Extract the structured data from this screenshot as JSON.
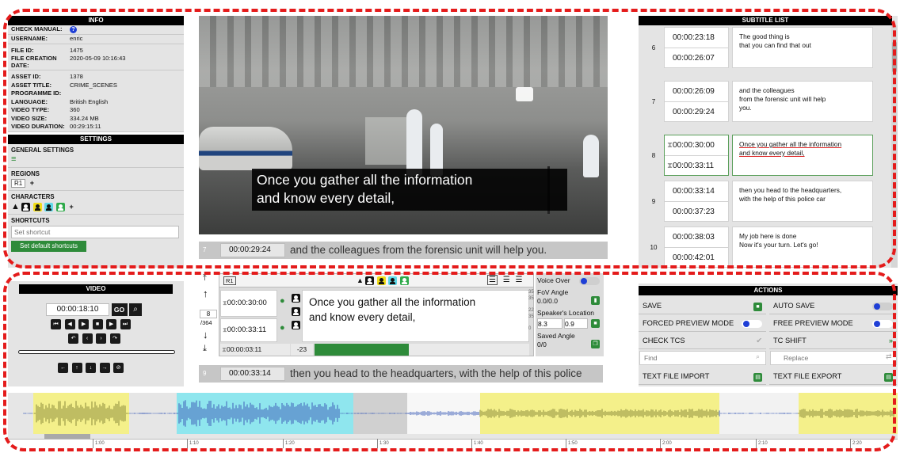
{
  "info": {
    "title": "INFO",
    "rows": [
      {
        "k": "CHECK MANUAL:",
        "v": ""
      },
      {
        "k": "USERNAME:",
        "v": "enric"
      },
      {
        "k": "FILE ID:",
        "v": "1475"
      },
      {
        "k": "FILE CREATION DATE:",
        "v": "2020-05-09 10:16:43"
      },
      {
        "k": "ASSET ID:",
        "v": "1378"
      },
      {
        "k": "ASSET TITLE:",
        "v": "CRIME_SCENES"
      },
      {
        "k": "PROGRAMME ID:",
        "v": ""
      },
      {
        "k": "LANGUAGE:",
        "v": "British English"
      },
      {
        "k": "VIDEO TYPE:",
        "v": "360"
      },
      {
        "k": "VIDEO SIZE:",
        "v": "334.24 MB"
      },
      {
        "k": "VIDEO DURATION:",
        "v": "00:29:15:11"
      }
    ]
  },
  "settings": {
    "title": "SETTINGS",
    "general": "GENERAL SETTINGS",
    "regions": "REGIONS",
    "region_chip": "R1",
    "characters": "CHARACTERS",
    "shortcuts": "SHORTCUTS",
    "shortcut_placeholder": "Set shortcut",
    "default_button": "Set default shortcuts"
  },
  "video": {
    "caption_l1": "Once you gather all the information",
    "caption_l2": "and know every detail,"
  },
  "strip_prev": {
    "num": "7",
    "tc": "00:00:29:24",
    "text": "and the colleagues from the forensic unit will help you."
  },
  "strip_next": {
    "num": "9",
    "tc": "00:00:33:14",
    "text": "then you head to the headquarters, with the help of this police"
  },
  "subtitles": {
    "title": "SUBTITLE LIST",
    "items": [
      {
        "num": "6",
        "in": "00:00:23:18",
        "out": "00:00:26:07",
        "l1": "The good thing is",
        "l2": "that you can find that out",
        "l3": ""
      },
      {
        "num": "7",
        "in": "00:00:26:09",
        "out": "00:00:29:24",
        "l1": "and the colleagues",
        "l2": "from the forensic unit will help",
        "l3": "you."
      },
      {
        "num": "8",
        "in": "00:00:30:00",
        "out": "00:00:33:11",
        "l1": "Once you gather all the information",
        "l2": "and know every detail,",
        "l3": ""
      },
      {
        "num": "9",
        "in": "00:00:33:14",
        "out": "00:00:37:23",
        "l1": "then you head to the headquarters,",
        "l2": "with the help of this police car",
        "l3": ""
      },
      {
        "num": "10",
        "in": "00:00:38:03",
        "out": "00:00:42:01",
        "l1": "My job here is done",
        "l2": "Now it's your turn. Let's go!",
        "l3": ""
      }
    ]
  },
  "video_ctrl": {
    "title": "VIDEO",
    "time": "00:00:18:10",
    "go": "GO"
  },
  "editor": {
    "region": "R1",
    "index": "8",
    "total": "/364",
    "tc_in": "00:00:30:00",
    "tc_out": "00:00:33:11",
    "tc_dur": "00:00:03:11",
    "delta": "-23",
    "line1": "Once you gather all the information",
    "line2": "and know every detail,",
    "count1": "35",
    "count2": "22",
    "count3": "35",
    "count4": "0",
    "count5": "35",
    "voice_over": "Voice Over",
    "fov_label": "FoV Angle",
    "fov_value": "0.0/0.0",
    "speaker_label": "Speaker's Location",
    "speaker_x": "8.3",
    "speaker_y": "0.9",
    "saved_label": "Saved Angle",
    "saved_value": "0/0"
  },
  "actions": {
    "title": "ACTIONS",
    "save": "SAVE",
    "auto_save": "AUTO SAVE",
    "forced_preview": "FORCED PREVIEW MODE",
    "free_preview": "FREE PREVIEW MODE",
    "check_tcs": "CHECK TCS",
    "tc_shift": "TC SHIFT",
    "find_placeholder": "Find",
    "replace_placeholder": "Replace",
    "import": "TEXT FILE IMPORT",
    "export": "TEXT FILE EXPORT"
  },
  "timeline": {
    "ticks": [
      "1:00",
      "1:10",
      "1:20",
      "1:30",
      "1:40",
      "1:50",
      "2:00",
      "2:10",
      "2:20"
    ]
  },
  "colors": {
    "green": "#2e8b3a",
    "accent_blue": "#1f3fd6",
    "yellow": "#f4f08a",
    "cyan": "#8fe6ee",
    "red_dash": "#e41b1b"
  }
}
